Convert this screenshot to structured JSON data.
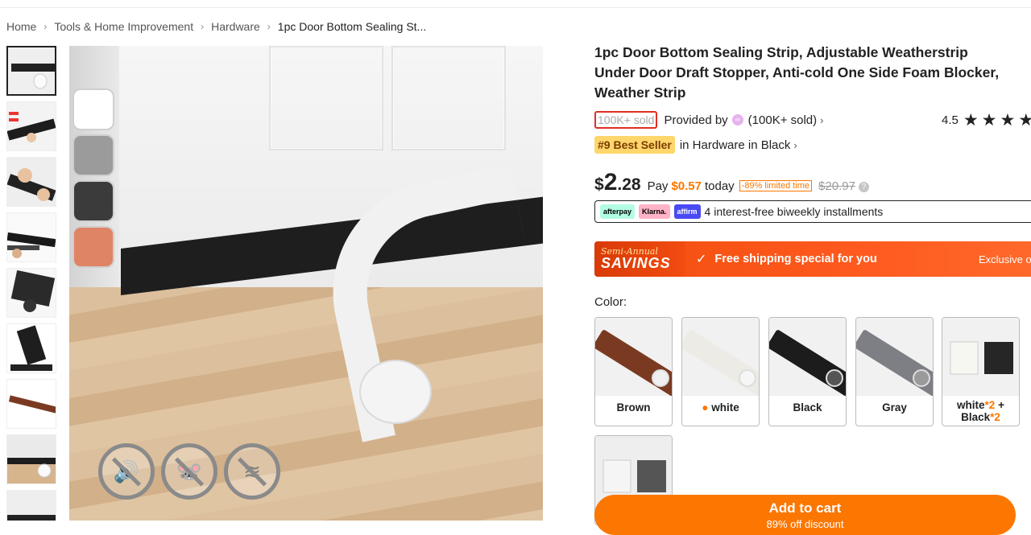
{
  "breadcrumb": [
    {
      "label": "Home"
    },
    {
      "label": "Tools & Home Improvement"
    },
    {
      "label": "Hardware"
    },
    {
      "label": "1pc Door Bottom Sealing St..."
    }
  ],
  "product": {
    "title": "1pc Door Bottom Sealing Strip, Adjustable Weatherstrip Under Door Draft Stopper, Anti-cold One Side Foam Blocker, Weather Strip",
    "sold_badge": "100K+ sold",
    "provided_by": "Provided by",
    "provider_sold": "(100K+ sold)",
    "rating": "4.5",
    "stars": "★★★★",
    "best_seller_rank": "#9 Best Seller",
    "best_seller_category": "in Hardware in Black"
  },
  "price": {
    "currency": "$",
    "integer": "2",
    "decimal": ".28",
    "pay_label": "Pay",
    "pay_amount": "$0.57",
    "pay_suffix": "today",
    "limited_badge": "-89% limited time",
    "original": "$20.97"
  },
  "installments": {
    "logos": [
      "afterpay",
      "Klarna.",
      "affirm"
    ],
    "text": "4 interest-free biweekly installments"
  },
  "promo": {
    "brand_line1": "Semi-Annual",
    "brand_line2": "SAVINGS",
    "shipping": "Free shipping special for you",
    "exclusive": "Exclusive offer"
  },
  "color": {
    "label": "Color:",
    "options": [
      {
        "label": "Brown",
        "swatch": "#7a3a22"
      },
      {
        "label": "white",
        "swatch": "#ecebe6"
      },
      {
        "label": "Black",
        "swatch": "#1c1c1c"
      },
      {
        "label": "Gray",
        "swatch": "#7d7f84"
      },
      {
        "label_a": "white",
        "label_b": "*2",
        "label_c": "+",
        "label_d": "Black",
        "label_e": "*2",
        "swatch": "#2a2a2a"
      },
      {
        "label": "",
        "swatch": "#e8e8e8"
      }
    ]
  },
  "image_swatches": [
    "#ffffff",
    "#9b9b9b",
    "#3b3b3b",
    "#e08466"
  ],
  "cart": {
    "label": "Add to cart",
    "sub": "89% off discount"
  },
  "colors": {
    "accent": "#fb7701",
    "highlight_border": "#e02e24",
    "best_seller_bg": "#ffd66b"
  }
}
